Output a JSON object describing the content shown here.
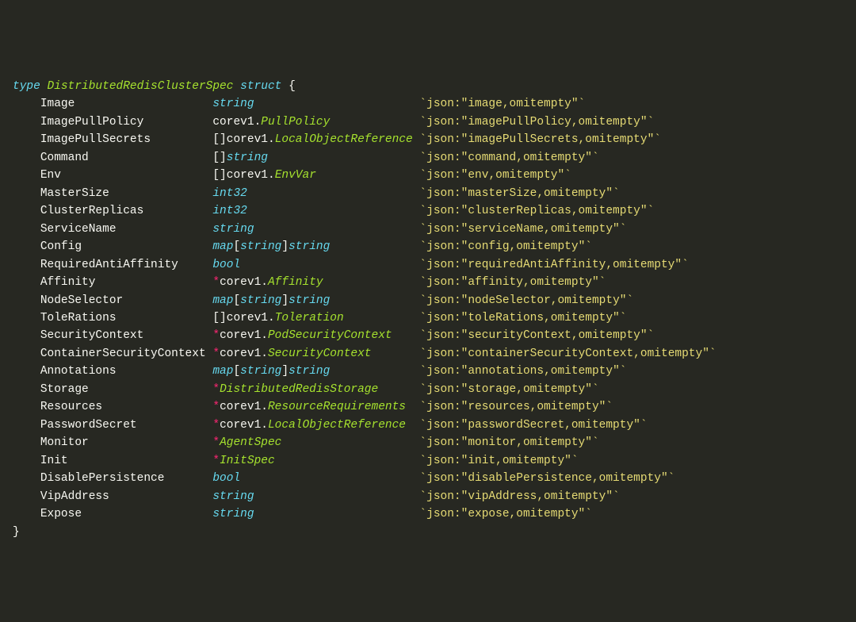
{
  "header": {
    "type_kw": "type",
    "struct_name": "DistributedRedisClusterSpec",
    "struct_kw": "struct",
    "brace_open": " {",
    "brace_close": "}"
  },
  "field_col_width": 25,
  "type_col_width": 30,
  "fields": [
    {
      "name": "Image",
      "type": [
        [
          "kw",
          "string"
        ]
      ],
      "tag": "`json:\"image,omitempty\"`"
    },
    {
      "name": "ImagePullPolicy",
      "type": [
        [
          "pkg",
          "corev1."
        ],
        [
          "name",
          "PullPolicy"
        ]
      ],
      "tag": "`json:\"imagePullPolicy,omitempty\"`"
    },
    {
      "name": "ImagePullSecrets",
      "type": [
        [
          "pkg",
          "[]corev1."
        ],
        [
          "name",
          "LocalObjectReference"
        ]
      ],
      "tag": "`json:\"imagePullSecrets,omitempty\"`"
    },
    {
      "name": "Command",
      "type": [
        [
          "pkg",
          "[]"
        ],
        [
          "kw",
          "string"
        ]
      ],
      "tag": "`json:\"command,omitempty\"`"
    },
    {
      "name": "Env",
      "type": [
        [
          "pkg",
          "[]corev1."
        ],
        [
          "name",
          "EnvVar"
        ]
      ],
      "tag": "`json:\"env,omitempty\"`"
    },
    {
      "name": "MasterSize",
      "type": [
        [
          "kw",
          "int32"
        ]
      ],
      "tag": "`json:\"masterSize,omitempty\"`"
    },
    {
      "name": "ClusterReplicas",
      "type": [
        [
          "kw",
          "int32"
        ]
      ],
      "tag": "`json:\"clusterReplicas,omitempty\"`"
    },
    {
      "name": "ServiceName",
      "type": [
        [
          "kw",
          "string"
        ]
      ],
      "tag": "`json:\"serviceName,omitempty\"`"
    },
    {
      "name": "Config",
      "type": [
        [
          "kw",
          "map"
        ],
        [
          "pkg",
          "["
        ],
        [
          "kw",
          "string"
        ],
        [
          "pkg",
          "]"
        ],
        [
          "kw",
          "string"
        ]
      ],
      "tag": "`json:\"config,omitempty\"`"
    },
    {
      "name": "RequiredAntiAffinity",
      "type": [
        [
          "kw",
          "bool"
        ]
      ],
      "tag": "`json:\"requiredAntiAffinity,omitempty\"`"
    },
    {
      "name": "Affinity",
      "type": [
        [
          "op",
          "*"
        ],
        [
          "pkg",
          "corev1."
        ],
        [
          "name",
          "Affinity"
        ]
      ],
      "tag": "`json:\"affinity,omitempty\"`"
    },
    {
      "name": "NodeSelector",
      "type": [
        [
          "kw",
          "map"
        ],
        [
          "pkg",
          "["
        ],
        [
          "kw",
          "string"
        ],
        [
          "pkg",
          "]"
        ],
        [
          "kw",
          "string"
        ]
      ],
      "tag": "`json:\"nodeSelector,omitempty\"`"
    },
    {
      "name": "ToleRations",
      "type": [
        [
          "pkg",
          "[]corev1."
        ],
        [
          "name",
          "Toleration"
        ]
      ],
      "tag": "`json:\"toleRations,omitempty\"`"
    },
    {
      "name": "SecurityContext",
      "type": [
        [
          "op",
          "*"
        ],
        [
          "pkg",
          "corev1."
        ],
        [
          "name",
          "PodSecurityContext"
        ]
      ],
      "tag": "`json:\"securityContext,omitempty\"`"
    },
    {
      "name": "ContainerSecurityContext",
      "type": [
        [
          "op",
          "*"
        ],
        [
          "pkg",
          "corev1."
        ],
        [
          "name",
          "SecurityContext"
        ]
      ],
      "tag": "`json:\"containerSecurityContext,omitempty\"`"
    },
    {
      "name": "Annotations",
      "type": [
        [
          "kw",
          "map"
        ],
        [
          "pkg",
          "["
        ],
        [
          "kw",
          "string"
        ],
        [
          "pkg",
          "]"
        ],
        [
          "kw",
          "string"
        ]
      ],
      "tag": "`json:\"annotations,omitempty\"`"
    },
    {
      "name": "Storage",
      "type": [
        [
          "op",
          "*"
        ],
        [
          "name",
          "DistributedRedisStorage"
        ]
      ],
      "tag": "`json:\"storage,omitempty\"`"
    },
    {
      "name": "Resources",
      "type": [
        [
          "op",
          "*"
        ],
        [
          "pkg",
          "corev1."
        ],
        [
          "name",
          "ResourceRequirements"
        ]
      ],
      "tag": "`json:\"resources,omitempty\"`"
    },
    {
      "name": "PasswordSecret",
      "type": [
        [
          "op",
          "*"
        ],
        [
          "pkg",
          "corev1."
        ],
        [
          "name",
          "LocalObjectReference"
        ]
      ],
      "tag": "`json:\"passwordSecret,omitempty\"`"
    },
    {
      "name": "Monitor",
      "type": [
        [
          "op",
          "*"
        ],
        [
          "name",
          "AgentSpec"
        ]
      ],
      "tag": "`json:\"monitor,omitempty\"`"
    },
    {
      "name": "Init",
      "type": [
        [
          "op",
          "*"
        ],
        [
          "name",
          "InitSpec"
        ]
      ],
      "tag": "`json:\"init,omitempty\"`"
    },
    {
      "name": "DisablePersistence",
      "type": [
        [
          "kw",
          "bool"
        ]
      ],
      "tag": "`json:\"disablePersistence,omitempty\"`"
    },
    {
      "name": "VipAddress",
      "type": [
        [
          "kw",
          "string"
        ]
      ],
      "tag": "`json:\"vipAddress,omitempty\"`"
    },
    {
      "name": "Expose",
      "type": [
        [
          "kw",
          "string"
        ]
      ],
      "tag": "`json:\"expose,omitempty\"`"
    }
  ]
}
